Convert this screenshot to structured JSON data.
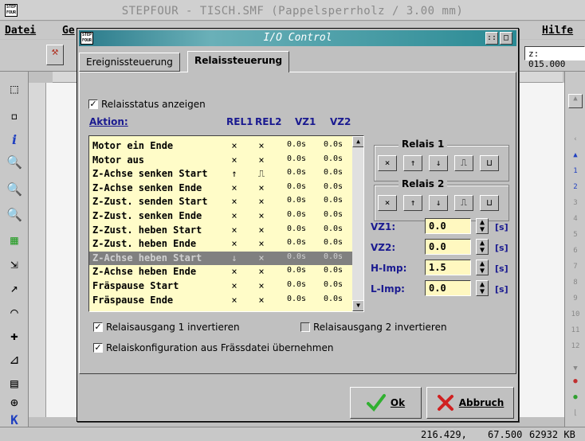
{
  "app": {
    "title": "STEPFOUR - TISCH.SMF (Pappelsperrholz / 3.00 mm)",
    "logo_text": "STEP FOUR",
    "z_coord": "z: 015.000"
  },
  "menubar": {
    "datei": "Datei",
    "ge": "Ge",
    "hilfe": "Hilfe"
  },
  "status": {
    "x": "216.429,",
    "y": "67.500",
    "mem": "62932 KB"
  },
  "dialog": {
    "title": "I/O Control",
    "tabs": [
      "Ereignissteuerung",
      "Relaissteuerung"
    ],
    "active_tab": "Relaissteuerung",
    "show_status_label": "Relaisstatus anzeigen",
    "show_status_checked": true,
    "columns": {
      "aktion": "Aktion:",
      "rel1": "REL1",
      "rel2": "REL2",
      "vz1": "VZ1",
      "vz2": "VZ2"
    },
    "rows": [
      {
        "name": "Motor ein Ende",
        "rel1": "×",
        "rel2": "×",
        "vz1": "0.0s",
        "vz2": "0.0s"
      },
      {
        "name": "Motor aus",
        "rel1": "×",
        "rel2": "×",
        "vz1": "0.0s",
        "vz2": "0.0s"
      },
      {
        "name": "Z-Achse senken Start",
        "rel1": "↑",
        "rel2": "⎍",
        "vz1": "0.0s",
        "vz2": "0.0s"
      },
      {
        "name": "Z-Achse senken Ende",
        "rel1": "×",
        "rel2": "×",
        "vz1": "0.0s",
        "vz2": "0.0s"
      },
      {
        "name": "Z-Zust. senden Start",
        "rel1": "×",
        "rel2": "×",
        "vz1": "0.0s",
        "vz2": "0.0s"
      },
      {
        "name": "Z-Zust. senken Ende",
        "rel1": "×",
        "rel2": "×",
        "vz1": "0.0s",
        "vz2": "0.0s"
      },
      {
        "name": "Z-Zust. heben Start",
        "rel1": "×",
        "rel2": "×",
        "vz1": "0.0s",
        "vz2": "0.0s"
      },
      {
        "name": "Z-Zust. heben Ende",
        "rel1": "×",
        "rel2": "×",
        "vz1": "0.0s",
        "vz2": "0.0s"
      },
      {
        "name": "Z-Achse heben Start",
        "rel1": "↓",
        "rel2": "×",
        "vz1": "0.0s",
        "vz2": "0.0s"
      },
      {
        "name": "Z-Achse heben Ende",
        "rel1": "×",
        "rel2": "×",
        "vz1": "0.0s",
        "vz2": "0.0s"
      },
      {
        "name": "Fräspause Start",
        "rel1": "×",
        "rel2": "×",
        "vz1": "0.0s",
        "vz2": "0.0s"
      },
      {
        "name": "Fräspause Ende",
        "rel1": "×",
        "rel2": "×",
        "vz1": "0.0s",
        "vz2": "0.0s"
      }
    ],
    "selected_row": 8,
    "relais1_label": "Relais 1",
    "relais2_label": "Relais 2",
    "relais_buttons": [
      "×",
      "↑",
      "↓",
      "⎍",
      "⊔"
    ],
    "vz1_label": "VZ1:",
    "vz1_value": "0.0",
    "vz2_label": "VZ2:",
    "vz2_value": "0.0",
    "himp_label": "H-Imp:",
    "himp_value": "1.5",
    "limp_label": "L-Imp:",
    "limp_value": "0.0",
    "unit": "[s]",
    "invert1_label": "Relaisausgang 1 invertieren",
    "invert1_checked": true,
    "invert2_label": "Relaisausgang 2 invertieren",
    "invert2_checked": false,
    "config_label": "Relaiskonfiguration aus Frässdatei übernehmen",
    "config_checked": true,
    "ok_label": "Ok",
    "cancel_label": "Abbruch"
  },
  "colors": {
    "accent_teal": "#2a7a8a",
    "list_bg": "#fffcc8",
    "label_blue": "#1a1a90",
    "ok_green": "#30b030",
    "cancel_red": "#d02020"
  }
}
